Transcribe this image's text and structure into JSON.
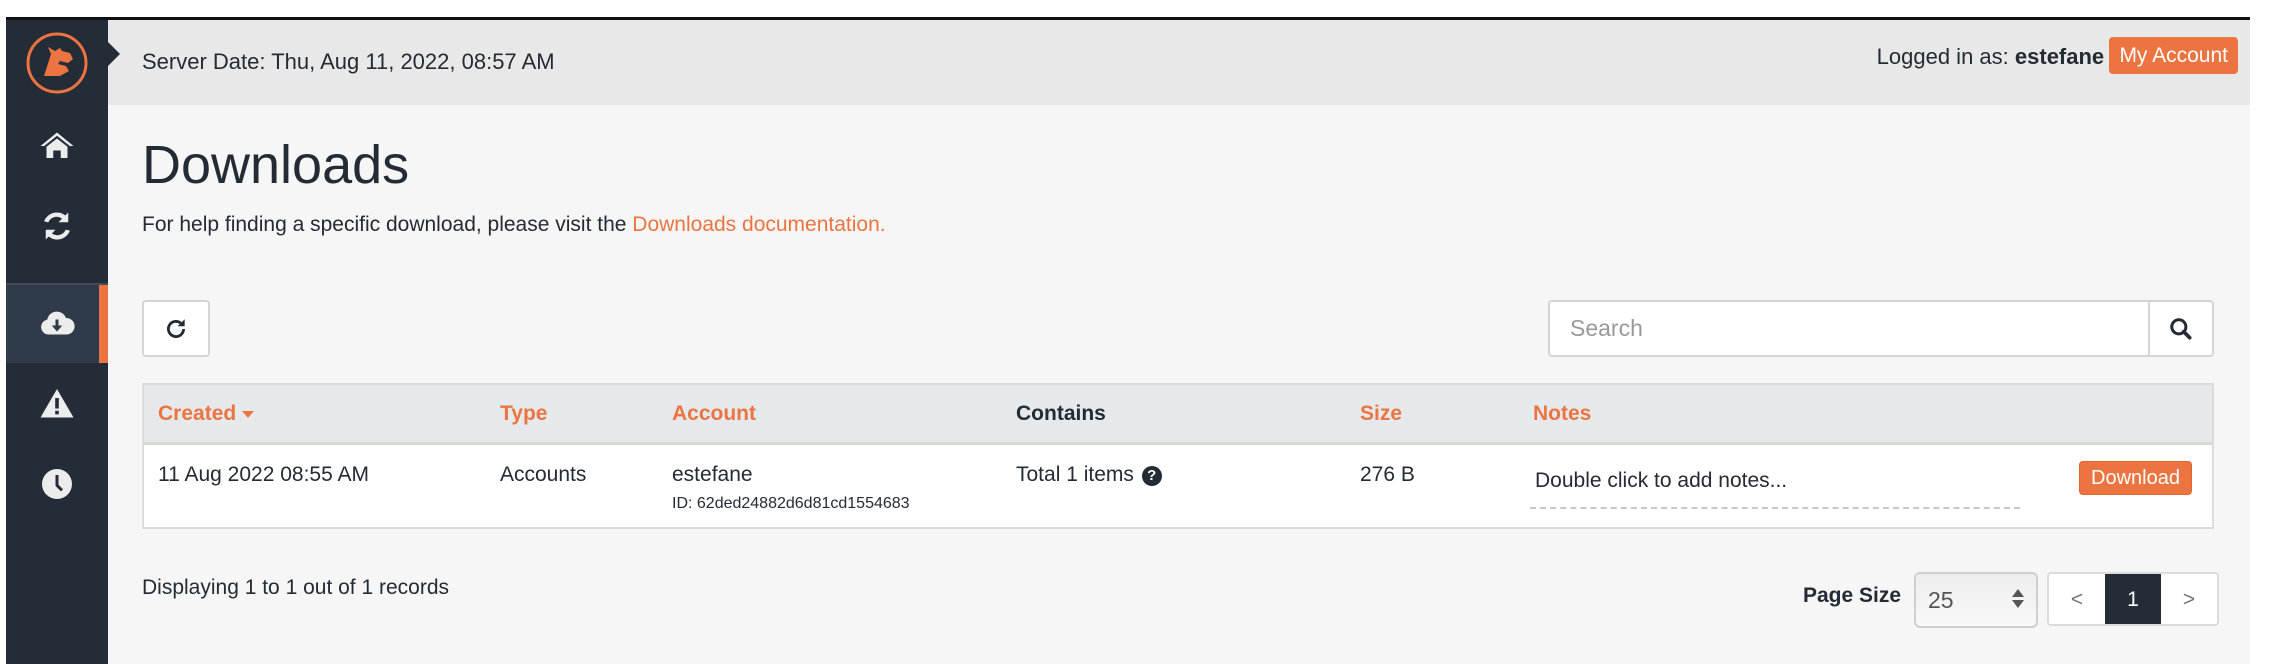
{
  "header": {
    "server_date": "Server Date: Thu, Aug 11, 2022, 08:57 AM",
    "logged_in_prefix": "Logged in as: ",
    "username": "estefane",
    "separator": " | ",
    "my_account_label": "My Account"
  },
  "sidebar": {
    "logo": "brand-logo",
    "items": [
      {
        "icon": "home-icon",
        "label": "Home",
        "active": false
      },
      {
        "icon": "sync-icon",
        "label": "Sync",
        "active": false
      },
      {
        "icon": "cloud-download-icon",
        "label": "Downloads",
        "active": true
      },
      {
        "icon": "warning-icon",
        "label": "Alerts",
        "active": false
      },
      {
        "icon": "clock-icon",
        "label": "History",
        "active": false
      }
    ]
  },
  "page": {
    "title": "Downloads",
    "help_text": "For help finding a specific download, please visit the ",
    "help_link": "Downloads documentation."
  },
  "toolbar": {
    "refresh_icon": "refresh-icon",
    "search_placeholder": "Search",
    "search_value": "",
    "search_icon": "search-icon"
  },
  "table": {
    "columns": [
      {
        "label": "Created",
        "sortable": true,
        "sorted": "desc"
      },
      {
        "label": "Type",
        "sortable": true
      },
      {
        "label": "Account",
        "sortable": true
      },
      {
        "label": "Contains",
        "sortable": false
      },
      {
        "label": "Size",
        "sortable": true
      },
      {
        "label": "Notes",
        "sortable": true
      }
    ],
    "rows": [
      {
        "created": "11 Aug 2022 08:55 AM",
        "type": "Accounts",
        "account": "estefane",
        "account_id": "ID: 62ded24882d6d81cd1554683",
        "contains": "Total 1 items",
        "contains_help": "?",
        "size": "276 B",
        "notes_placeholder": "Double click to add notes...",
        "action_label": "Download"
      }
    ]
  },
  "footer": {
    "displaying": "Displaying 1 to 1 out of 1 records",
    "page_size_label": "Page Size",
    "page_size_value": "25",
    "pager": {
      "prev": "<",
      "current": "1",
      "next": ">"
    }
  },
  "colors": {
    "accent": "#ec7440",
    "sidebar": "#232c37",
    "text": "#232b35"
  }
}
